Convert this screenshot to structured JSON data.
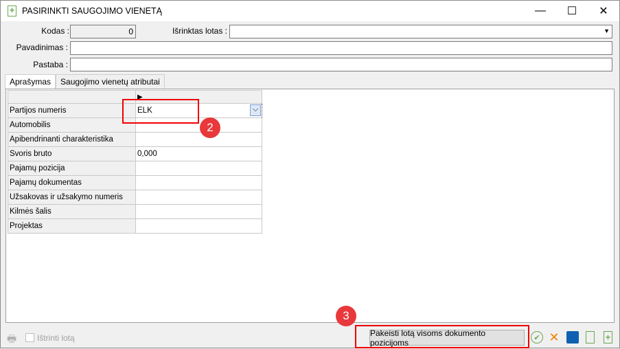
{
  "window": {
    "title": "PASIRINKTI SAUGOJIMO VIENETĄ",
    "minimize": "—",
    "maximize": "☐",
    "close": "✕"
  },
  "form": {
    "kodas_label": "Kodas :",
    "kodas_value": "0",
    "lotas_label": "Išrinktas lotas :",
    "lotas_value": "",
    "pavadinimas_label": "Pavadinimas :",
    "pavadinimas_value": "",
    "pastaba_label": "Pastaba :",
    "pastaba_value": ""
  },
  "tabs": [
    {
      "label": "Aprašymas"
    },
    {
      "label": "Saugojimo vienetų atributai"
    }
  ],
  "grid": {
    "rows": [
      {
        "name": "Partijos numeris",
        "value": "ELK"
      },
      {
        "name": "Automobilis",
        "value": ""
      },
      {
        "name": "Apibendrinanti charakteristika",
        "value": ""
      },
      {
        "name": "Svoris bruto",
        "value": "0,000"
      },
      {
        "name": "Pajamų pozicija",
        "value": ""
      },
      {
        "name": "Pajamų dokumentas",
        "value": ""
      },
      {
        "name": "Užsakovas ir užsakymo numeris",
        "value": ""
      },
      {
        "name": "Kilmės šalis",
        "value": ""
      },
      {
        "name": "Projektas",
        "value": ""
      }
    ]
  },
  "badges": {
    "b2": "2",
    "b3": "3"
  },
  "footer": {
    "delete_lot_label": "Ištrinti lotą",
    "change_lot_button": "Pakeisti lotą visoms dokumento pozicijoms"
  },
  "colors": {
    "highlight": "#e00000",
    "badge": "#e8383b",
    "green": "#6aa84f",
    "orange": "#f08000",
    "blue": "#1060b0"
  }
}
